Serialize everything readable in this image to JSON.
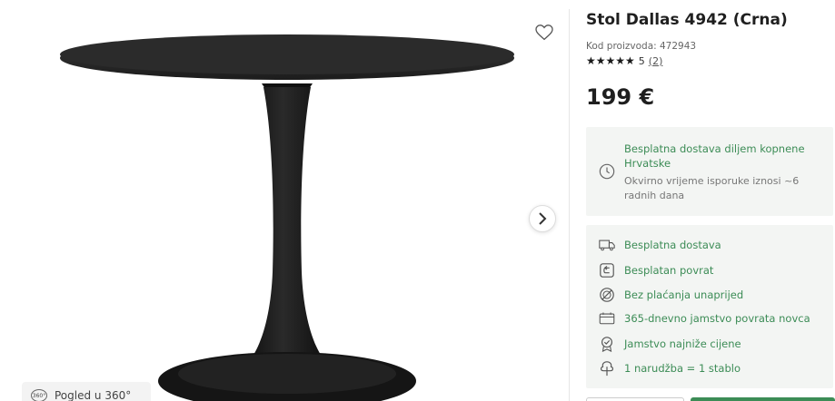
{
  "gallery": {
    "image_icon": "product-table-image",
    "wishlist_icon": "heart-icon",
    "next_icon": "chevron-right-icon",
    "view360_label": "Pogled u 360°",
    "view360_icon_text": "360°"
  },
  "product": {
    "title": "Stol Dallas 4942 (Crna)",
    "code": "Kod proizvoda: 472943",
    "stars": "★★★★★",
    "rating": "5",
    "review_count": "(2)",
    "price": "199 €"
  },
  "delivery": {
    "title": "Besplatna dostava diljem kopnene Hrvatske",
    "subtitle": "Okvirno vrijeme isporuke iznosi ~6 radnih dana",
    "icon": "clock-icon"
  },
  "benefits": [
    {
      "label": "Besplatna dostava",
      "icon": "truck-icon"
    },
    {
      "label": "Besplatan povrat",
      "icon": "return-icon"
    },
    {
      "label": "Bez plaćanja unaprijed",
      "icon": "no-payment-icon"
    },
    {
      "label": "365-dnevno jamstvo povrata novca",
      "icon": "calendar-icon"
    },
    {
      "label": "Jamstvo najniže cijene",
      "icon": "badge-icon"
    },
    {
      "label": "1 narudžba = 1 stablo",
      "icon": "tree-icon"
    }
  ],
  "colors": {
    "accent_green": "#3c8c56",
    "panel_bg": "#f3f5f3"
  }
}
